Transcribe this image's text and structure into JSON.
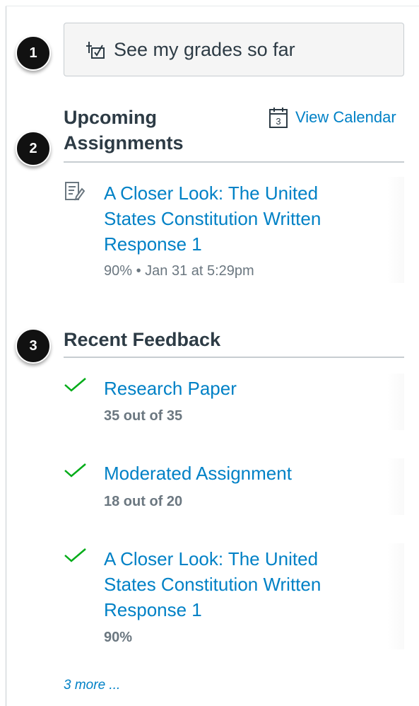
{
  "callouts": [
    "1",
    "2",
    "3"
  ],
  "grades_button": {
    "label": "See my grades so far",
    "icon": "grades-checklist-icon"
  },
  "upcoming": {
    "title_line1": "Upcoming",
    "title_line2": "Assignments",
    "view_calendar": {
      "label": "View Calendar",
      "icon": "calendar-icon",
      "day": "3"
    },
    "items": [
      {
        "icon": "assignment-icon",
        "title_lines": [
          "A Closer Look: The United",
          "States Constitution Written",
          "Response 1"
        ],
        "meta": "90% • Jan 31 at 5:29pm"
      }
    ]
  },
  "feedback": {
    "title": "Recent Feedback",
    "items": [
      {
        "icon": "check-icon",
        "title_lines": [
          "Research Paper"
        ],
        "score": "35 out of 35"
      },
      {
        "icon": "check-icon",
        "title_lines": [
          "Moderated Assignment"
        ],
        "score": "18 out of 20"
      },
      {
        "icon": "check-icon",
        "title_lines": [
          "A Closer Look: The United",
          "States Constitution Written",
          "Response 1"
        ],
        "score": "90%"
      }
    ],
    "more": "3 more ..."
  },
  "colors": {
    "link": "#0081c6",
    "check": "#00ac18",
    "text": "#2d3b45",
    "muted": "#6b7780"
  }
}
